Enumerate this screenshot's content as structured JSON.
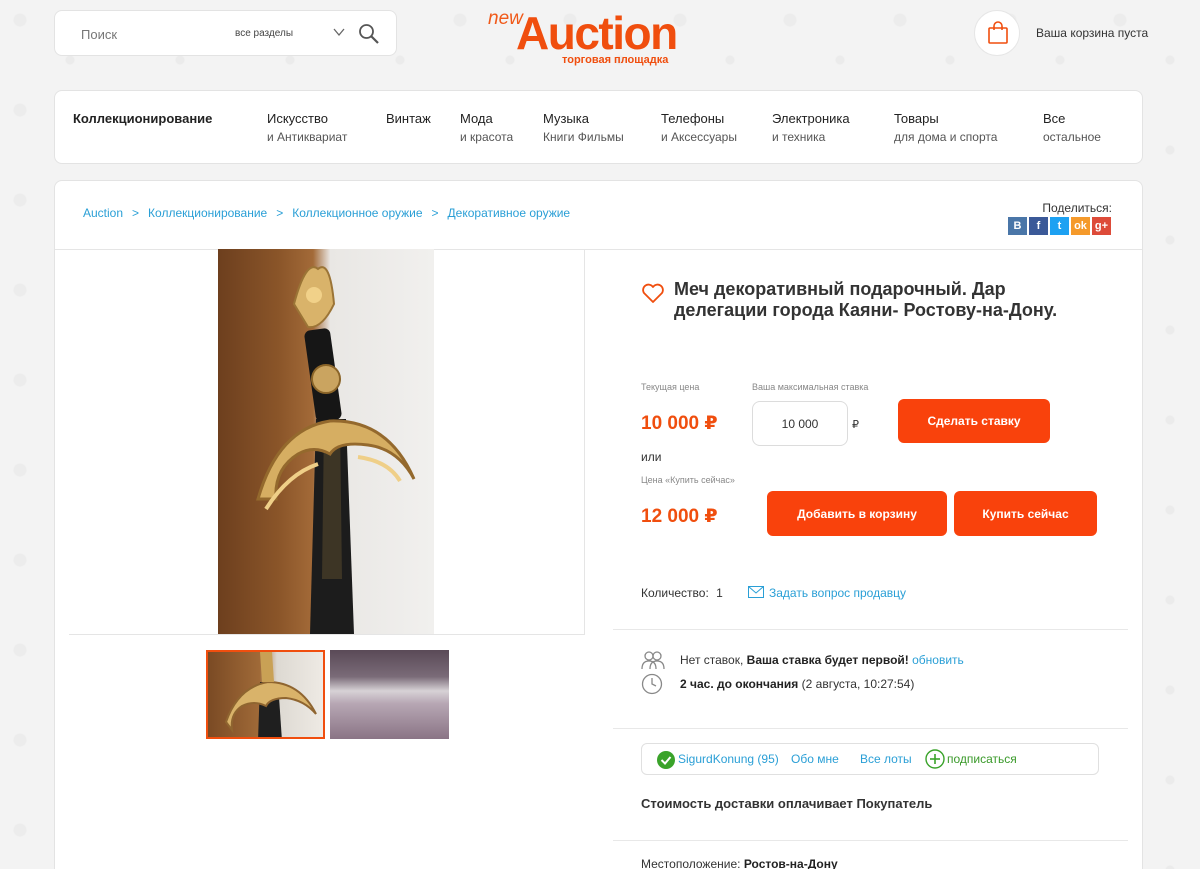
{
  "search": {
    "placeholder": "Поиск",
    "section": "все разделы"
  },
  "logo": {
    "prefix": "new",
    "main": "Auction",
    "tagline": "торговая площадка"
  },
  "cart": {
    "status": "Ваша корзина пуста"
  },
  "categories": [
    {
      "line1": "Коллекционирование",
      "line2": ""
    },
    {
      "line1": "Искусство",
      "line2": "и Антиквариат"
    },
    {
      "line1": "Винтаж",
      "line2": ""
    },
    {
      "line1": "Мода",
      "line2": "и красота"
    },
    {
      "line1": "Музыка",
      "line2": "Книги Фильмы"
    },
    {
      "line1": "Телефоны",
      "line2": "и Аксессуары"
    },
    {
      "line1": "Электроника",
      "line2": "и техника"
    },
    {
      "line1": "Товары",
      "line2": "для дома и спорта"
    },
    {
      "line1": "Все",
      "line2": "остальное"
    }
  ],
  "breadcrumbs": [
    "Auction",
    "Коллекционирование",
    "Коллекционное оружие",
    "Декоративное оружие"
  ],
  "share": {
    "label": "Поделиться:",
    "networks": [
      {
        "icon": "vk-icon",
        "glyph": "В",
        "color": "#4a76a8"
      },
      {
        "icon": "facebook-icon",
        "glyph": "f",
        "color": "#3b5998"
      },
      {
        "icon": "twitter-icon",
        "glyph": "t",
        "color": "#1da1f2"
      },
      {
        "icon": "odnoklassniki-icon",
        "glyph": "ok",
        "color": "#f59a2b"
      },
      {
        "icon": "googleplus-icon",
        "glyph": "g+",
        "color": "#dd4b39"
      }
    ]
  },
  "product": {
    "title": "Меч декоративный подарочный. Дар делегации города Каяни- Ростову-на-Дону.",
    "current_price_label": "Текущая цена",
    "current_price": "10 000 ₽",
    "max_bid_label": "Ваша максимальная ставка",
    "max_bid_value": "10 000",
    "currency": "₽",
    "bid_button": "Сделать ставку",
    "or_label": "или",
    "buy_now_label": "Цена «Купить сейчас»",
    "buy_now_price": "12 000 ₽",
    "add_to_cart_button": "Добавить в корзину",
    "buy_now_button": "Купить сейчас",
    "quantity_label": "Количество:",
    "quantity": "1",
    "ask_seller": "Задать вопрос продавцу"
  },
  "bids": {
    "none": "Нет ставок,",
    "first": "Ваша ставка будет первой!",
    "refresh": "обновить",
    "time_left": "2 час. до окончания",
    "end_date": "(2 августа, 10:27:54)"
  },
  "seller": {
    "name": "SigurdKonung (95)",
    "about": "Обо мне",
    "all_lots": "Все лоты",
    "subscribe": "подписаться"
  },
  "delivery": "Стоимость доставки оплачивает Покупатель",
  "location": {
    "label": "Местоположение:",
    "value": "Ростов-на-Дону"
  },
  "colors": {
    "accent": "#f04e0e",
    "button": "#f9420c",
    "link": "#2a9fd6",
    "subscribe": "#3a9a2a"
  }
}
